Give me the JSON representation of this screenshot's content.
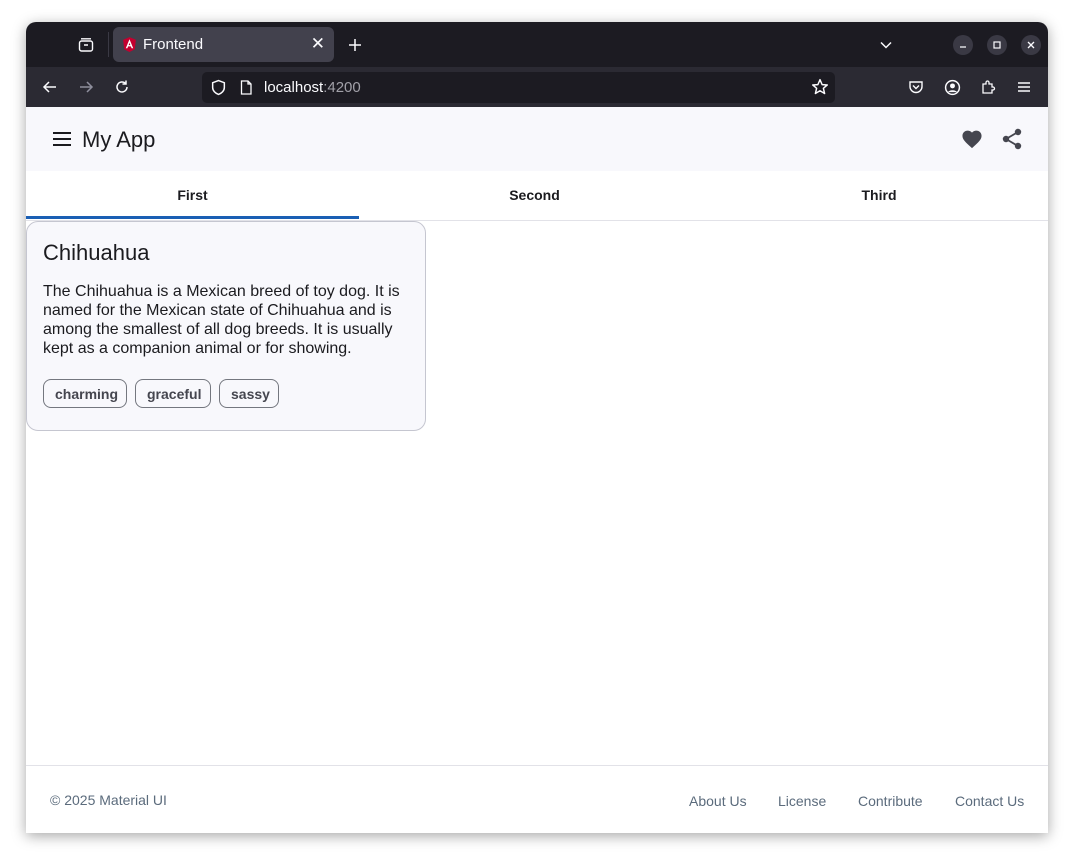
{
  "browser": {
    "tab_title": "Frontend",
    "url_host": "localhost",
    "url_port": ":4200"
  },
  "app": {
    "title": "My App",
    "tabs": [
      {
        "label": "First",
        "selected": true
      },
      {
        "label": "Second",
        "selected": false
      },
      {
        "label": "Third",
        "selected": false
      }
    ]
  },
  "card": {
    "title": "Chihuahua",
    "description": "The Chihuahua is a Mexican breed of toy dog. It is named for the Mexican state of Chihuahua and is among the smallest of all dog breeds. It is usually kept as a companion animal or for showing.",
    "chips": [
      "charming",
      "graceful",
      "sassy"
    ]
  },
  "footer": {
    "copyright": "© 2025 Material UI",
    "links": [
      "About Us",
      "License",
      "Contribute",
      "Contact Us"
    ]
  },
  "icons": {
    "toolbar": [
      "menu-icon",
      "heart-icon",
      "share-icon"
    ],
    "browser": [
      "tab-list-icon",
      "back-icon",
      "forward-icon",
      "reload-icon",
      "shield-icon",
      "page-icon",
      "bookmark-star-icon",
      "pocket-icon",
      "account-icon",
      "extensions-icon",
      "app-menu-icon"
    ]
  },
  "colors": {
    "accent": "#1a5fb4",
    "surface": "#f8f8fc",
    "browser_dark": "#1c1b22"
  }
}
